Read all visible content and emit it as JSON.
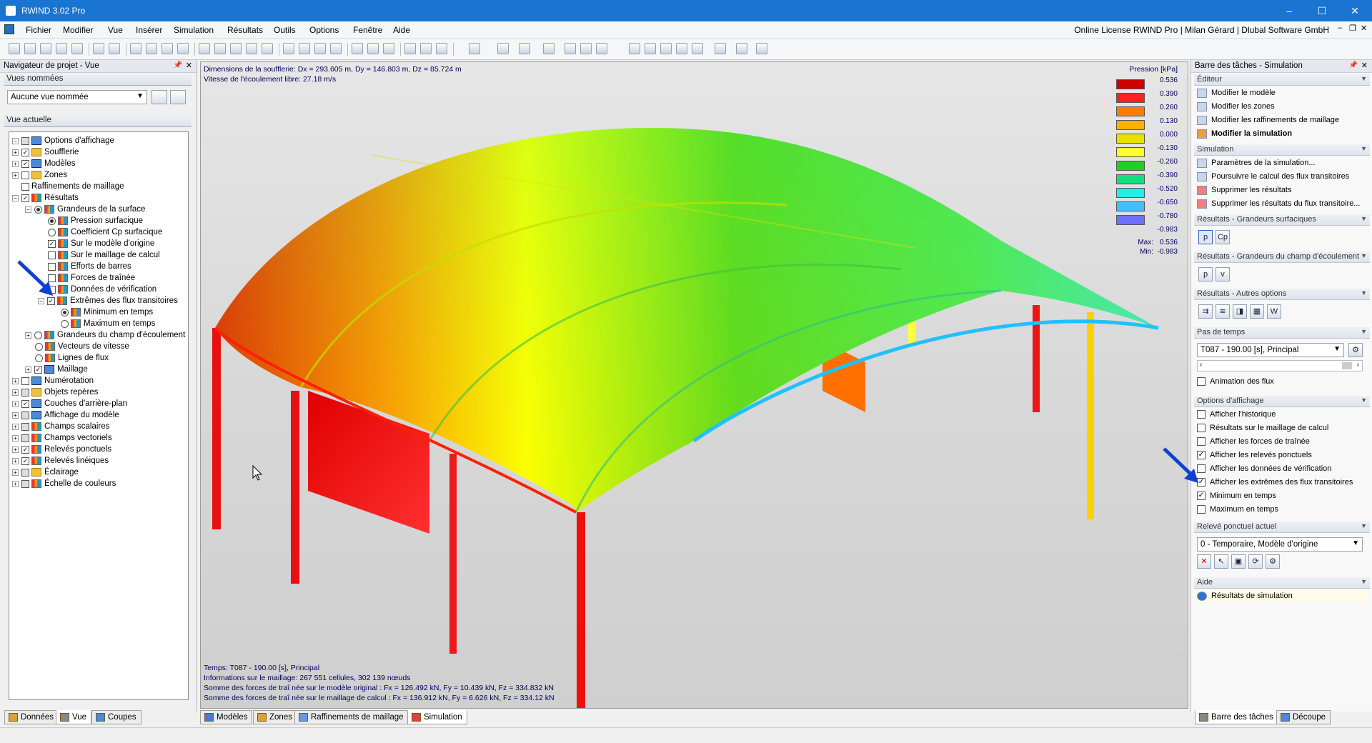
{
  "window": {
    "title": "RWIND 3.02 Pro",
    "min": "–",
    "max": "☐",
    "close": "✕"
  },
  "menu": {
    "items": [
      "Fichier",
      "Modifier",
      "Vue",
      "Insérer",
      "Simulation",
      "Résultats",
      "Outils",
      "Options",
      "Fenêtre",
      "Aide"
    ],
    "license": "Online License RWIND Pro | Milan Gérard | Dlubal Software GmbH"
  },
  "left": {
    "header": "Navigateur de projet - Vue",
    "named_views_label": "Vues nommées",
    "named_view_value": "Aucune vue nommée",
    "current_view_label": "Vue actuelle",
    "tree": [
      {
        "label": "Options d'affichage",
        "lvl": 0
      },
      {
        "label": "Soufflerie",
        "lvl": 1
      },
      {
        "label": "Modèles",
        "lvl": 1
      },
      {
        "label": "Zones",
        "lvl": 1
      },
      {
        "label": "Raffinements de maillage",
        "lvl": 1
      },
      {
        "label": "Résultats",
        "lvl": 1
      },
      {
        "label": "Grandeurs de la surface",
        "lvl": 2
      },
      {
        "label": "Pression surfacique",
        "lvl": 3
      },
      {
        "label": "Coefficient Cp surfacique",
        "lvl": 3
      },
      {
        "label": "Sur le modèle d'origine",
        "lvl": 3
      },
      {
        "label": "Sur le maillage de calcul",
        "lvl": 3
      },
      {
        "label": "Efforts de barres",
        "lvl": 3
      },
      {
        "label": "Forces de traînée",
        "lvl": 3
      },
      {
        "label": "Données de vérification",
        "lvl": 3
      },
      {
        "label": "Extrêmes des flux transitoires",
        "lvl": 3
      },
      {
        "label": "Minimum en temps",
        "lvl": 4
      },
      {
        "label": "Maximum en temps",
        "lvl": 4
      },
      {
        "label": "Grandeurs du champ d'écoulement",
        "lvl": 2
      },
      {
        "label": "Vecteurs de vitesse",
        "lvl": 2
      },
      {
        "label": "Lignes de flux",
        "lvl": 2
      },
      {
        "label": "Maillage",
        "lvl": 2
      },
      {
        "label": "Numérotation",
        "lvl": 1
      },
      {
        "label": "Objets repères",
        "lvl": 1
      },
      {
        "label": "Couches d'arrière-plan",
        "lvl": 1
      },
      {
        "label": "Affichage du modèle",
        "lvl": 1
      },
      {
        "label": "Champs scalaires",
        "lvl": 1
      },
      {
        "label": "Champs vectoriels",
        "lvl": 1
      },
      {
        "label": "Relevés ponctuels",
        "lvl": 1
      },
      {
        "label": "Relevés linéiques",
        "lvl": 1
      },
      {
        "label": "Éclairage",
        "lvl": 1
      },
      {
        "label": "Échelle de couleurs",
        "lvl": 1
      }
    ],
    "tabs": [
      "Données",
      "Vue",
      "Coupes"
    ]
  },
  "viewport": {
    "info_top": [
      "Dimensions de la soufflerie: Dx = 293.605 m, Dy = 146.803 m, Dz = 85.724 m",
      "Vitesse de l'écoulement libre: 27.18 m/s"
    ],
    "info_bottom": [
      "Temps: T087 - 190.00 [s], Principal",
      "Informations sur le maillage: 267 551 cellules, 302 139 nœuds",
      "Somme des forces de traî née sur le modèle original : Fx = 126.492 kN, Fy = 10.439 kN, Fz = 334.832 kN",
      "Somme des forces de traî née sur le maillage de calcul : Fx = 136.912 kN, Fy = 6.626 kN, Fz = 334.12 kN"
    ],
    "legend": {
      "title": "Pression [kPa]",
      "values": [
        "0.536",
        "0.390",
        "0.260",
        "0.130",
        "0.000",
        "-0.130",
        "-0.260",
        "-0.390",
        "-0.520",
        "-0.650",
        "-0.780",
        "-0.983"
      ],
      "colors": [
        "#cc0000",
        "#ff2020",
        "#ff7a00",
        "#ffb000",
        "#e8e000",
        "#ffff30",
        "#20d020",
        "#10e080",
        "#20f0e0",
        "#40c0ff",
        "#7070ff",
        "#0000e0"
      ],
      "max_label": "Max:",
      "max": "0.536",
      "min_label": "Min:",
      "min": "-0.983"
    },
    "tabs": [
      "Modèles",
      "Zones",
      "Raffinements de maillage",
      "Simulation"
    ]
  },
  "right": {
    "header": "Barre des tâches - Simulation",
    "editor": {
      "title": "Éditeur",
      "items": [
        "Modifier le modèle",
        "Modifier les zones",
        "Modifier les raffinements de maillage",
        "Modifier la simulation"
      ]
    },
    "simulation": {
      "title": "Simulation",
      "items": [
        "Paramètres de la simulation...",
        "Poursuivre le calcul des flux transitoires",
        "Supprimer les résultats",
        "Supprimer les résultats du flux transitoire..."
      ]
    },
    "res_surf": {
      "title": "Résultats - Grandeurs surfaciques",
      "btns": [
        "p",
        "Cp"
      ]
    },
    "res_flow": {
      "title": "Résultats - Grandeurs du champ d'écoulement",
      "btns": [
        "p",
        "v"
      ]
    },
    "res_other": {
      "title": "Résultats - Autres options"
    },
    "timestep": {
      "title": "Pas de temps",
      "value": "T087 - 190.00 [s], Principal",
      "anim": "Animation des flux"
    },
    "display": {
      "title": "Options d'affichage",
      "items": [
        {
          "label": "Afficher l'historique",
          "checked": false
        },
        {
          "label": "Résultats sur le maillage de calcul",
          "checked": false
        },
        {
          "label": "Afficher les forces de traînée",
          "checked": false
        },
        {
          "label": "Afficher les relevés ponctuels",
          "checked": true
        },
        {
          "label": "Afficher les données de vérification",
          "checked": false
        },
        {
          "label": "Afficher les extrêmes des flux transitoires",
          "checked": true
        },
        {
          "label": "Minimum en temps",
          "checked": true
        },
        {
          "label": "Maximum en temps",
          "checked": false
        }
      ]
    },
    "probe": {
      "title": "Relevé ponctuel actuel",
      "value": "0 - Temporaire, Modèle d'origine"
    },
    "help": {
      "title": "Aide",
      "item": "Résultats de simulation"
    },
    "tabs": [
      "Barre des tâches",
      "Découpe"
    ]
  }
}
